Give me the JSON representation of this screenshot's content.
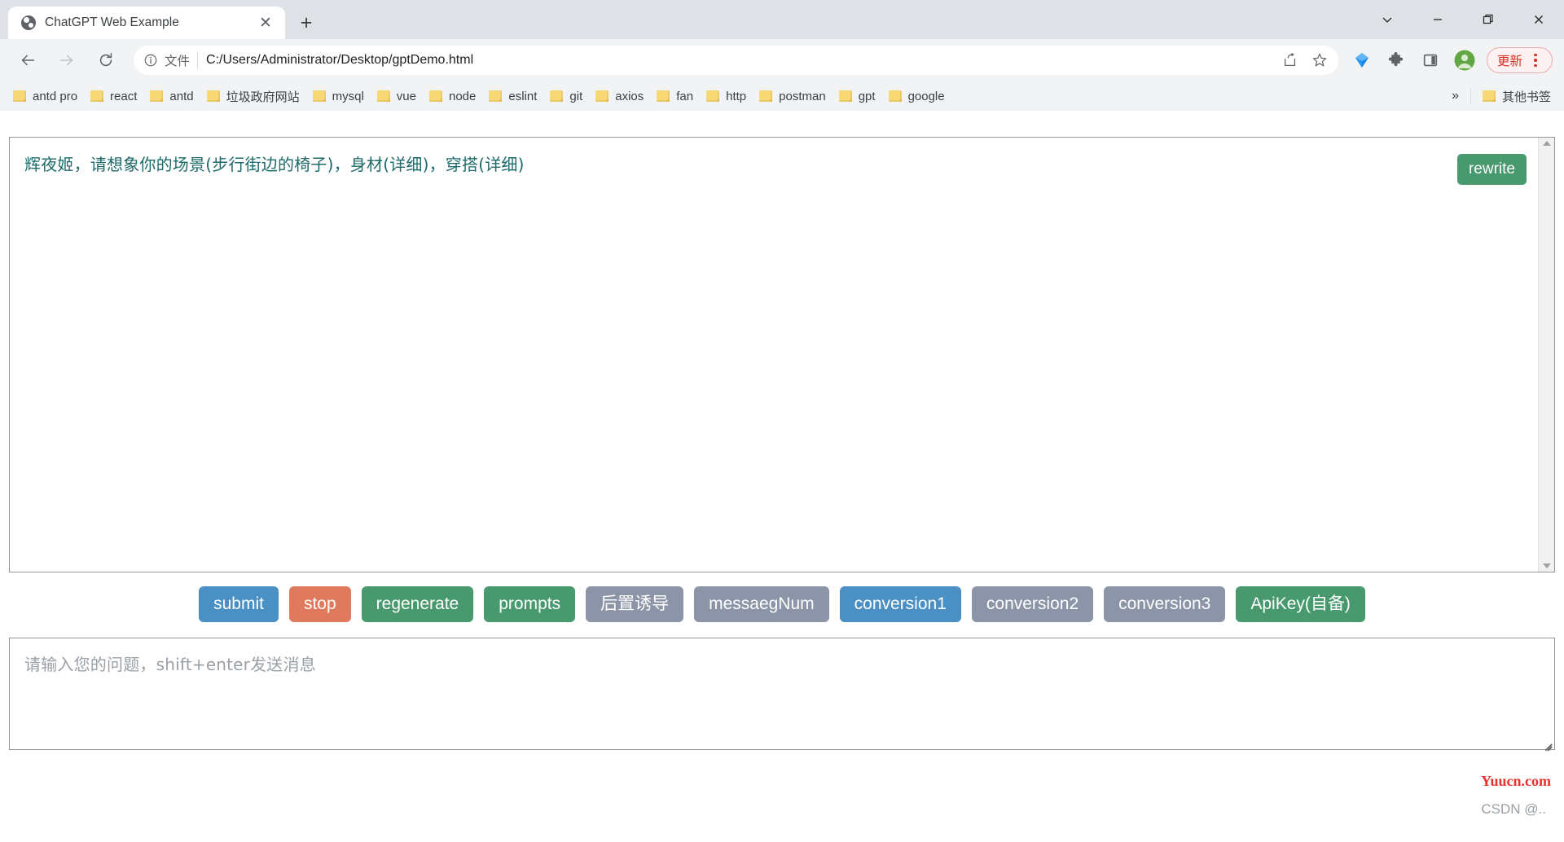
{
  "window": {
    "controls": [
      {
        "name": "tab-search-button",
        "glyph": "⌄"
      },
      {
        "name": "minimize-button",
        "glyph": "—"
      },
      {
        "name": "maximize-button",
        "glyph": "❐"
      },
      {
        "name": "close-button",
        "glyph": "✕"
      }
    ]
  },
  "tab": {
    "title": "ChatGPT Web Example",
    "close_glyph": "✕",
    "newtab_glyph": "+",
    "favicon_name": "globe-icon"
  },
  "toolbar": {
    "back_glyph": "←",
    "forward_glyph": "→",
    "reload_glyph": "⟳",
    "info_glyph": "ⓘ",
    "file_label": "文件",
    "url": "C:/Users/Administrator/Desktop/gptDemo.html",
    "share_glyph": "↪",
    "star_glyph": "☆",
    "update_label": "更新",
    "accent_update": "#d93025"
  },
  "bookmarks": {
    "items": [
      {
        "label": "antd pro"
      },
      {
        "label": "react"
      },
      {
        "label": "antd"
      },
      {
        "label": "垃圾政府网站"
      },
      {
        "label": "mysql"
      },
      {
        "label": "vue"
      },
      {
        "label": "node"
      },
      {
        "label": "eslint"
      },
      {
        "label": "git"
      },
      {
        "label": "axios"
      },
      {
        "label": "fan"
      },
      {
        "label": "http"
      },
      {
        "label": "postman"
      },
      {
        "label": "gpt"
      },
      {
        "label": "google"
      }
    ],
    "overflow_glyph": "»",
    "other_bookmarks": "其他书签"
  },
  "chat": {
    "message": "辉夜姬，请想象你的场景(步行街边的椅子)，身材(详细)，穿搭(详细)",
    "message_color": "#1d6a6a",
    "rewrite_label": "rewrite",
    "rewrite_color": "#49996f",
    "scroll_up_glyph": "▲",
    "scroll_down_glyph": "▼"
  },
  "actions": [
    {
      "label": "submit",
      "color": "#4a90c4"
    },
    {
      "label": "stop",
      "color": "#e07a5f"
    },
    {
      "label": "regenerate",
      "color": "#49996f"
    },
    {
      "label": "prompts",
      "color": "#49996f"
    },
    {
      "label": "后置诱导",
      "color": "#8c95a8"
    },
    {
      "label": "messaegNum",
      "color": "#8c95a8"
    },
    {
      "label": "conversion1",
      "color": "#4a90c4"
    },
    {
      "label": "conversion2",
      "color": "#8c95a8"
    },
    {
      "label": "conversion3",
      "color": "#8c95a8"
    },
    {
      "label": "ApiKey(自备)",
      "color": "#49996f"
    }
  ],
  "input": {
    "placeholder": "请输入您的问题，shift+enter发送消息",
    "value": ""
  },
  "watermarks": {
    "red": "Yuucn.com",
    "red_color": "#e8322a",
    "gray": "CSDN @.."
  }
}
